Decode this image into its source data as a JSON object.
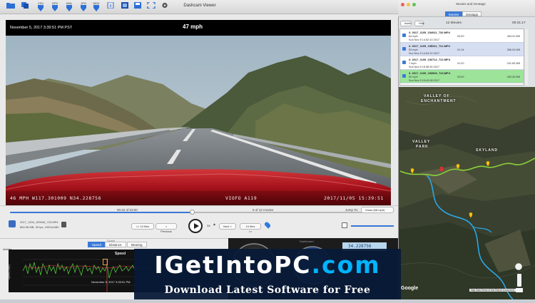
{
  "main": {
    "window_title": "Dashcam Viewer",
    "toolbar": [
      {
        "icon": "open-folder-icon",
        "label": ""
      },
      {
        "icon": "copy-files-icon",
        "label": ""
      },
      {
        "icon": "export-csv-icon",
        "label": "CSV"
      },
      {
        "icon": "export-gpx-icon",
        "label": "GPX"
      },
      {
        "icon": "export-kml-icon",
        "label": "KML"
      },
      {
        "icon": "export-jpg-icon",
        "label": "JPG"
      },
      {
        "icon": "export-mov-icon",
        "label": "MOV"
      },
      {
        "icon": "info-icon",
        "label": ""
      },
      {
        "icon": "film-icon",
        "label": ""
      },
      {
        "icon": "save-icon",
        "label": ""
      },
      {
        "icon": "fullscreen-icon",
        "label": ""
      },
      {
        "icon": "gear-icon",
        "label": ""
      }
    ],
    "osd": {
      "date": "November 5, 2017 3:39:51 PM PST",
      "speed": "47 mph"
    },
    "video_stamp": {
      "left": "46 MPH W117.301009 N34.228756",
      "center": "VIOFO A119",
      "right": "2017/11/05 15:39:51"
    },
    "controls": {
      "time": "00:42 of 03:00",
      "file_count": "6 of 12 movies",
      "jump_to_label": "Jump To:",
      "jump_to_value": "Vmax (68 mph)",
      "prev10": "<< 10 files",
      "prev": "< Previous",
      "speed_label": "1x",
      "next": "Next >",
      "next10": "10 files >>",
      "file_info_1": "2017_1105_153949_723.MP4",
      "file_info_2": "854.36 MB, 30 fps, 1920x1080"
    },
    "graph": {
      "panel_title": "Graph",
      "tabs": [
        "Speed",
        "Distance",
        "Bearing"
      ],
      "active_tab": 0,
      "plot_title": "Speed",
      "axis_label": "Speed (mph)",
      "corner_label": "Antelde",
      "date_label": "November 5, 2017 3:39:51 PM"
    },
    "dashboard": {
      "panel_title": "Dashboard",
      "readout": "34.228756"
    }
  },
  "right": {
    "window_title": "Movies and Geotags",
    "tabs": [
      "Movies",
      "Geotags"
    ],
    "active_tab": 0,
    "insert_label": "Insert",
    "hide_label": "Hide",
    "movie_count": "12 Movies",
    "total_duration": "00:31:17",
    "movies": [
      {
        "name": "3. 2017_1105_154911_720.MP4",
        "speed": "64 mph",
        "duration": "03:00",
        "size": "453.22 MB",
        "date": "Sun Nov 5 14:52:10 2017",
        "state": "normal"
      },
      {
        "name": "3. 2017_1105_155311_721.MP4",
        "speed": "53 mph",
        "duration": "01:14",
        "size": "356.04 MB",
        "date": "Sun Nov 5 14:54:22 2017",
        "state": "selected"
      },
      {
        "name": "3. 2017_1105_153712_722.MP4",
        "speed": "7 mph",
        "duration": "01:20",
        "size": "201.83 MB",
        "date": "Sun Nov 5 15:38:30 2017",
        "state": "normal"
      },
      {
        "name": "3. 2017_1105_153506_723.MP4",
        "speed": "52 mph",
        "duration": "03:00",
        "size": "453.26 MB",
        "date": "Sun Nov 5 15:42:08 2017",
        "state": "playing"
      }
    ],
    "map": {
      "label_valley_1": "VALLEY OF",
      "label_valley_2": "ENCHANTMENT",
      "label_valley_park_1": "VALLEY",
      "label_valley_park_2": "PARK",
      "label_skyland": "SKYLAND",
      "google_logo": "Google",
      "footer": "Map Data   Terms of Use   Report a map error"
    }
  },
  "watermark": {
    "brand_part1": "IGetIntoPC",
    "brand_part2": ".com",
    "tagline": "Download Latest Software for Free"
  },
  "colors": {
    "accent_blue": "#3b7ad8",
    "route_blue": "#29a8e8",
    "route_green": "#8ad13a",
    "watermark_bg": "#081a38",
    "watermark_accent": "#00b4ff",
    "car_hood": "#b3141f"
  }
}
